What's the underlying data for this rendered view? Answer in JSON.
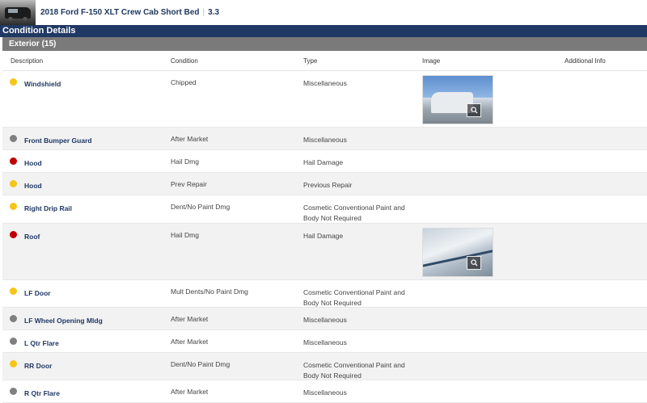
{
  "header": {
    "vehicle_title": "2018 Ford F-150 XLT Crew Cab Short Bed",
    "grade": "3.3"
  },
  "section": {
    "title": "Condition Details"
  },
  "group": {
    "title": "Exterior (15)"
  },
  "columns": [
    "Description",
    "Condition",
    "Type",
    "Image",
    "Additional Info"
  ],
  "colors": {
    "yellow": "#f5c518",
    "gray": "#808080",
    "red": "#c00000"
  },
  "rows": [
    {
      "description": "Windshield",
      "condition": "Chipped",
      "type": "Miscellaneous",
      "severity": "yellow",
      "has_image": true,
      "image_icon": "zoom-icon"
    },
    {
      "description": "Front Bumper Guard",
      "condition": "After Market",
      "type": "Miscellaneous",
      "severity": "gray",
      "has_image": false
    },
    {
      "description": "Hood",
      "condition": "Hail Dmg",
      "type": "Hail Damage",
      "severity": "red",
      "has_image": false
    },
    {
      "description": "Hood",
      "condition": "Prev Repair",
      "type": "Previous Repair",
      "severity": "yellow",
      "has_image": false
    },
    {
      "description": "Right Drip Rail",
      "condition": "Dent/No Paint Dmg",
      "type": "Cosmetic Conventional Paint and Body Not Required",
      "severity": "yellow",
      "has_image": false
    },
    {
      "description": "Roof",
      "condition": "Hail Dmg",
      "type": "Hail Damage",
      "severity": "red",
      "has_image": true,
      "image_icon": "zoom-icon"
    },
    {
      "description": "LF Door",
      "condition": "Mult Dents/No Paint Dmg",
      "type": "Cosmetic Conventional Paint and Body Not Required",
      "severity": "yellow",
      "has_image": false
    },
    {
      "description": "LF Wheel Opening Mldg",
      "condition": "After Market",
      "type": "Miscellaneous",
      "severity": "gray",
      "has_image": false
    },
    {
      "description": "L Qtr Flare",
      "condition": "After Market",
      "type": "Miscellaneous",
      "severity": "gray",
      "has_image": false
    },
    {
      "description": "RR Door",
      "condition": "Dent/No Paint Dmg",
      "type": "Cosmetic Conventional Paint and Body Not Required",
      "severity": "yellow",
      "has_image": false
    },
    {
      "description": "R Qtr Flare",
      "condition": "After Market",
      "type": "Miscellaneous",
      "severity": "gray",
      "has_image": false
    }
  ]
}
